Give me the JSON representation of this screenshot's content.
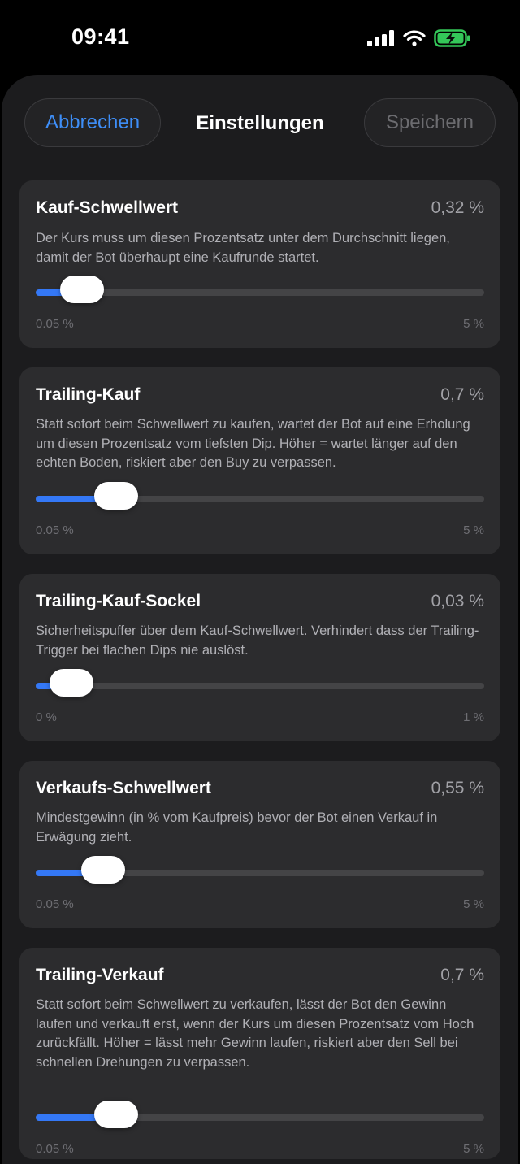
{
  "status": {
    "time": "09:41"
  },
  "nav": {
    "cancel": "Abbrechen",
    "title": "Einstellungen",
    "save": "Speichern"
  },
  "colors": {
    "accent": "#3478f6",
    "card": "#2c2c2e",
    "sheet": "#1c1c1e",
    "battery": "#34c759"
  },
  "settings": [
    {
      "title": "Kauf-Schwellwert",
      "value": "0,32 %",
      "description": "Der Kurs muss um diesen Prozentsatz unter dem Durchschnitt liegen, damit der Bot überhaupt eine Kaufrunde startet.",
      "min_label": "0.05 %",
      "max_label": "5 %",
      "level": 0.055
    },
    {
      "title": "Trailing-Kauf",
      "value": "0,7 %",
      "description": "Statt sofort beim Schwellwert zu kaufen, wartet der Bot auf eine Erholung um diesen Prozentsatz vom tiefsten Dip. Höher = wartet länger auf den echten Boden, riskiert aber den Buy zu verpassen.",
      "min_label": "0.05 %",
      "max_label": "5 %",
      "level": 0.131
    },
    {
      "title": "Trailing-Kauf-Sockel",
      "value": "0,03 %",
      "description": "Sicherheitspuffer über dem Kauf-Schwellwert. Verhindert dass der Trailing-Trigger bei flachen Dips nie auslöst.",
      "min_label": "0 %",
      "max_label": "1 %",
      "level": 0.03
    },
    {
      "title": "Verkaufs-Schwellwert",
      "value": "0,55 %",
      "description": "Mindestgewinn (in % vom Kaufpreis) bevor der Bot einen Verkauf in Erwägung zieht.",
      "min_label": "0.05 %",
      "max_label": "5 %",
      "level": 0.101
    },
    {
      "title": "Trailing-Verkauf",
      "value": "0,7 %",
      "description": "Statt sofort beim Schwellwert zu verkaufen, lässt der Bot den Gewinn laufen und verkauft erst, wenn der Kurs um diesen Prozentsatz vom Hoch zurückfällt. Höher = lässt mehr Gewinn laufen, riskiert aber den Sell bei schnellen Drehungen zu verpassen.",
      "min_label": "0.05 %",
      "max_label": "5 %",
      "level": 0.131
    }
  ]
}
